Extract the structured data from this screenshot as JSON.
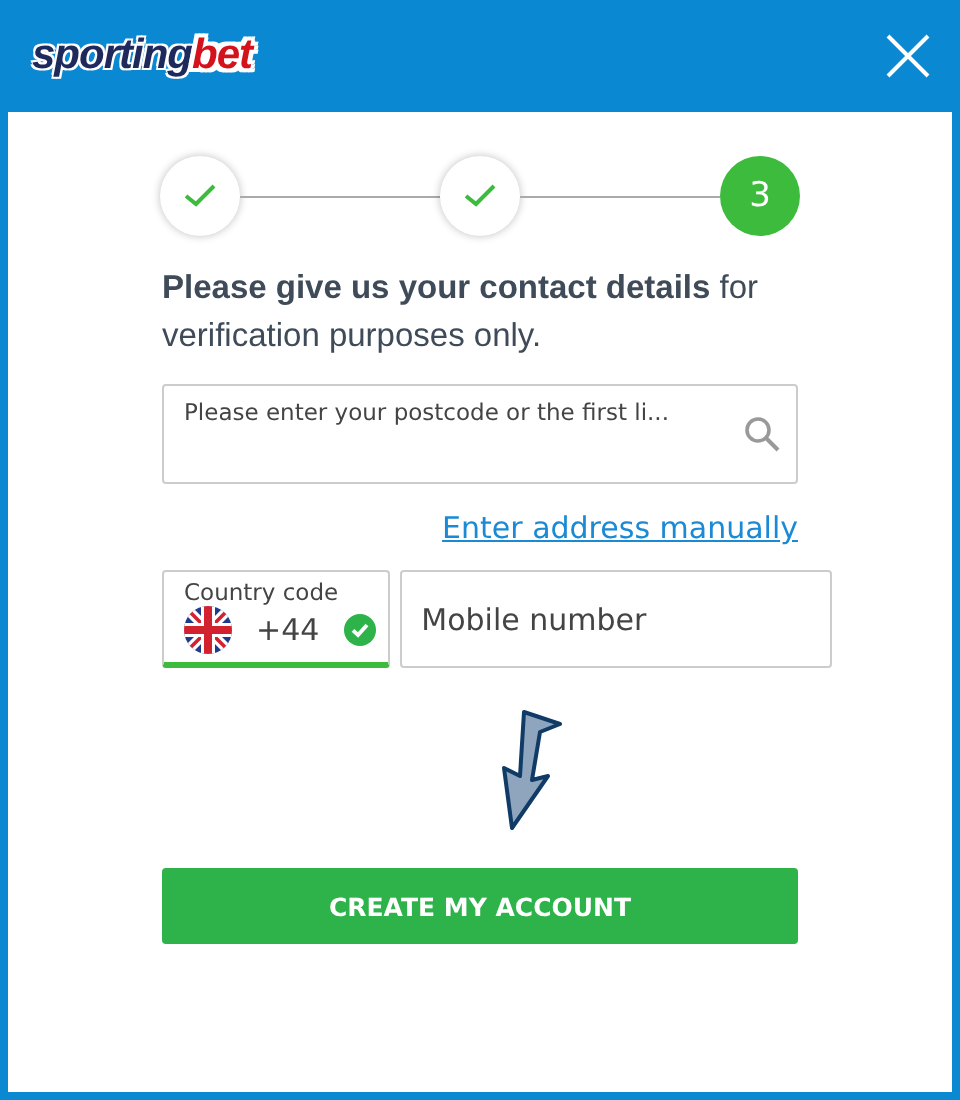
{
  "header": {
    "logo": {
      "part_1": "sporting",
      "part_2": "bet"
    }
  },
  "steps": [
    {
      "completed": true
    },
    {
      "completed": true
    },
    {
      "completed": false,
      "label": "3"
    }
  ],
  "intro": "**Please give us your contact details** for verification purposes only.",
  "address": {
    "placeholder": "Please enter your postcode or the first li..."
  },
  "manual_link": "Enter address manually",
  "country_code": {
    "label": "Country code",
    "value": "+44",
    "valid": true
  },
  "mobile": {
    "placeholder": "Mobile number"
  },
  "submit": "CREATE MY ACCOUNT"
}
